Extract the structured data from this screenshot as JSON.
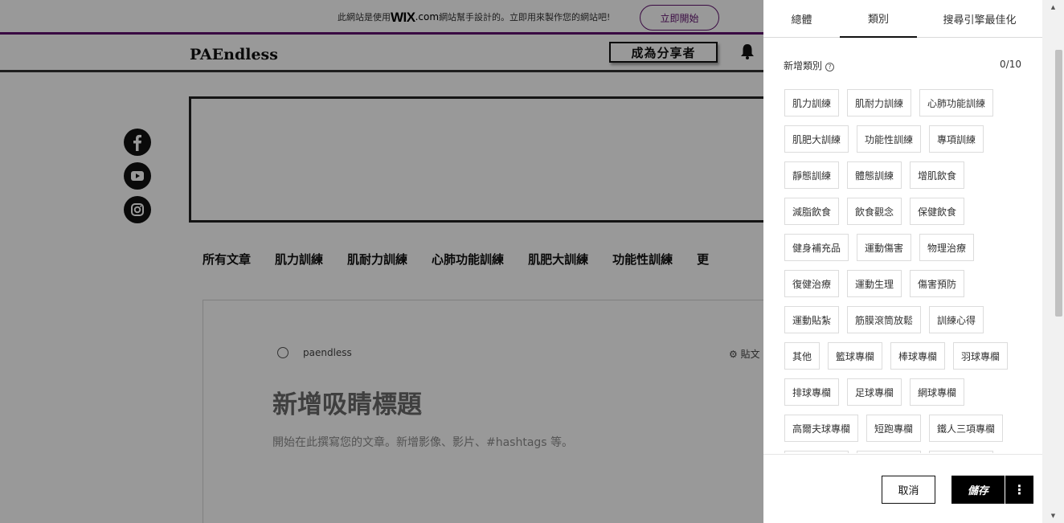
{
  "wix_bar": {
    "message_prefix": "此網站是使用",
    "logo": "WIX",
    "logo_domain": ".com",
    "message_suffix": "網站幫手設計的。立即用來製作您的網站吧!",
    "cta_label": "立即開始",
    "accent_color": "#60106e"
  },
  "header": {
    "site_title": "PAEndless",
    "share_button": "成為分享者",
    "bell_icon": "bell-icon"
  },
  "social": [
    "facebook-icon",
    "youtube-icon",
    "instagram-icon"
  ],
  "category_nav": [
    "所有文章",
    "肌力訓練",
    "肌耐力訓練",
    "心肺功能訓練",
    "肌肥大訓練",
    "功能性訓練",
    "更"
  ],
  "post": {
    "author": "paendless",
    "settings_label": "貼文",
    "title": "新增吸睛標題",
    "body": "開始在此撰寫您的文章。新增影像、影片、#hashtags 等。"
  },
  "panel": {
    "tabs": [
      "總體",
      "類別",
      "搜尋引擎最佳化"
    ],
    "active_tab": "類別",
    "add_category_label": "新增類別",
    "count": "0/10",
    "tags": [
      [
        "肌力訓練",
        "肌耐力訓練",
        "心肺功能訓練"
      ],
      [
        "肌肥大訓練",
        "功能性訓練",
        "專項訓練"
      ],
      [
        "靜態訓練",
        "體態訓練",
        "增肌飲食"
      ],
      [
        "減脂飲食",
        "飲食觀念",
        "保健飲食"
      ],
      [
        "健身補充品",
        "運動傷害",
        "物理治療"
      ],
      [
        "復健治療",
        "運動生理",
        "傷害預防"
      ],
      [
        "運動貼紮",
        "筋膜滾筒放鬆",
        "訓練心得"
      ],
      [
        "其他",
        "籃球專欄",
        "棒球專欄",
        "羽球專欄"
      ],
      [
        "排球專欄",
        "足球專欄",
        "網球專欄"
      ],
      [
        "高爾夫球專欄",
        "短跑專欄",
        "鐵人三項專欄"
      ],
      [
        "",
        "",
        ""
      ]
    ],
    "cancel_label": "取消",
    "save_label": "儲存",
    "more_label": "⋮"
  }
}
